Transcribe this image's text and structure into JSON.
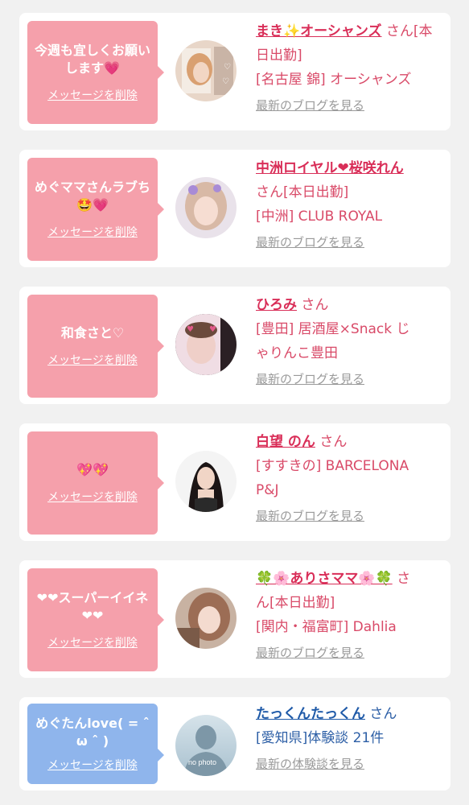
{
  "cards": [
    {
      "message": "今週も宜しくお願いします💗",
      "delete_label": "メッセージを削除",
      "name": "まき✨オーシャンズ",
      "suffix": "さん[本日出勤]",
      "line2": "[名古屋 錦] オーシャンズ",
      "line3": "",
      "blog_label": "最新のブログを見る"
    },
    {
      "message": "めぐママさんラブち🤩💗",
      "delete_label": "メッセージを削除",
      "name": "中洲ロイヤル❤桜咲れん",
      "suffix": "さん[本日出勤]",
      "line2": "[中洲] CLUB ROYAL",
      "line3": "",
      "blog_label": "最新のブログを見る"
    },
    {
      "message": "和食さと♡",
      "delete_label": "メッセージを削除",
      "name": "ひろみ",
      "suffix": "さん",
      "line2": "[豊田] 居酒屋×Snack じ",
      "line3": "ゃりんこ豊田",
      "blog_label": "最新のブログを見る"
    },
    {
      "message": "💖💖",
      "delete_label": "メッセージを削除",
      "name": "白望 のん",
      "suffix": "さん",
      "line2": "[すすきの] BARCELONA",
      "line3": "P&J",
      "blog_label": "最新のブログを見る"
    },
    {
      "message": "❤❤スーパーイイネ❤❤",
      "delete_label": "メッセージを削除",
      "name": "🍀🌸ありさママ🌸🍀",
      "suffix": "さん[本日出勤]",
      "line2": "[関内・福富町] Dahlia",
      "line3": "",
      "blog_label": "最新のブログを見る"
    },
    {
      "message": "めぐたんlove( = ˆ ω ˆ )",
      "delete_label": "メッセージを削除",
      "name": "たっくんたっくん",
      "suffix": "さん",
      "line2": "[愛知県]体験談 21件",
      "line3": "",
      "blog_label": "最新の体験談を見る",
      "avatar_text": "no photo"
    }
  ],
  "colors": {
    "pink_bubble": "#f5a0ab",
    "blue_bubble": "#8fb5ec",
    "pink_text": "#d94a68",
    "blue_text": "#1f5aa8"
  }
}
